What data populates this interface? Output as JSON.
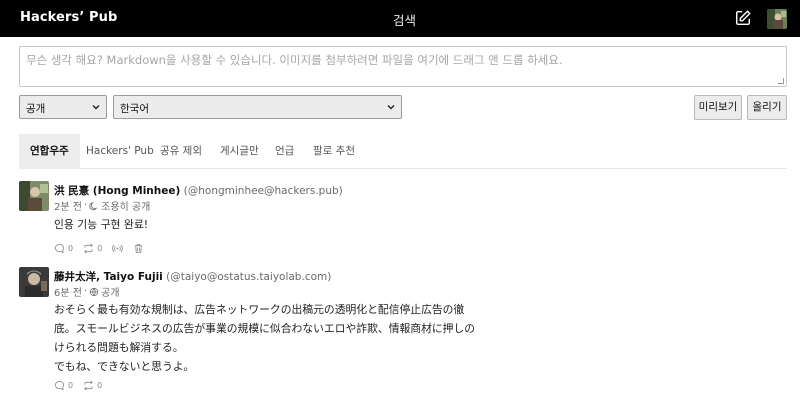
{
  "header": {
    "brand": "Hackers’ Pub",
    "search_label": "검색",
    "compose_icon": "pencil-square-icon",
    "avatar_icon": "user-avatar"
  },
  "composer": {
    "placeholder": "무슨 생각 해요? Markdown을 사용할 수 있습니다. 이미지를 첨부하려면 파일을 여기에 드래그 앤 드롭 하세요.",
    "visibility": "공개",
    "language": "한국어",
    "preview_label": "미리보기",
    "post_label": "올리기"
  },
  "tabs": [
    {
      "label": "연합우주",
      "active": true
    },
    {
      "label": "Hackers' Pub"
    },
    {
      "label": "공유 제외"
    },
    {
      "label": "게시글만"
    },
    {
      "label": "언급"
    },
    {
      "label": "팔로 추천"
    }
  ],
  "posts": [
    {
      "name": "洪 民憙 (Hong Minhee)",
      "handle": "(@hongminhee@hackers.pub)",
      "time": "2분 전",
      "visibility": "조용히 공개",
      "visibility_icon": "moon-icon",
      "lines": [
        "인용 기능 구현 완료!"
      ],
      "reply_count": "0",
      "share_count": "0"
    },
    {
      "name": "藤井太洋, Taiyo Fujii",
      "handle": "(@taiyo@ostatus.taiyolab.com)",
      "time": "6분 전",
      "visibility": "공개",
      "visibility_icon": "globe-icon",
      "lines": [
        "おそらく最も有効な規制は、広告ネットワークの出稿元の透明化と配信停止広告の徹",
        "底。スモールビジネスの広告が事業の規模に似合わないエロや詐欺、情報商材に押しの",
        "けられる問題も解消する。",
        "でもね、できないと思うよ。"
      ],
      "reply_count": "0",
      "share_count": "0"
    }
  ],
  "colors": {
    "header_bg": "#000000",
    "tab_active_bg": "#ededed",
    "muted_text": "#6a6a6a"
  }
}
